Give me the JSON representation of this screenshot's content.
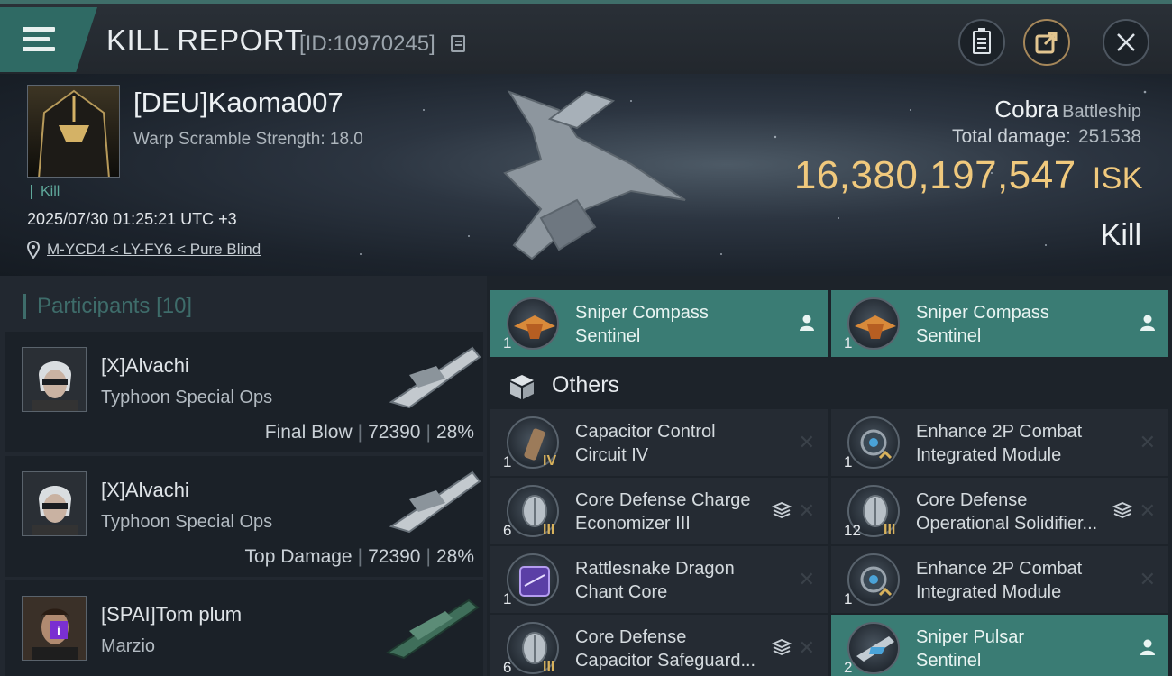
{
  "header": {
    "title": "KILL REPORT",
    "kill_id": "[ID:10970245]"
  },
  "victim": {
    "name": "[DEU]Kaoma007",
    "warp_scramble": "Warp Scramble Strength: 18.0",
    "tag": "Kill",
    "datetime": "2025/07/30 01:25:21 UTC +3",
    "location": "M-YCD4 < LY-FY6 < Pure Blind",
    "ship": "Cobra",
    "ship_class": "Battleship",
    "total_damage_label": "Total damage:",
    "total_damage": "251538",
    "isk_value": "16,380,197,547",
    "isk_unit": "ISK",
    "result": "Kill"
  },
  "participants": {
    "header": "Participants",
    "count": "[10]",
    "list": [
      {
        "name": "[X]Alvachi",
        "ship": "Typhoon Special Ops",
        "role": "Final Blow",
        "damage": "72390",
        "percent": "28%"
      },
      {
        "name": "[X]Alvachi",
        "ship": "Typhoon Special Ops",
        "role": "Top Damage",
        "damage": "72390",
        "percent": "28%"
      },
      {
        "name": "[SPAI]Tom plum",
        "ship": "Marzio"
      }
    ]
  },
  "items": {
    "top": [
      {
        "name_line1": "Sniper Compass",
        "name_line2": "Sentinel",
        "qty": "1"
      },
      {
        "name_line1": "Sniper Compass",
        "name_line2": "Sentinel",
        "qty": "1"
      }
    ],
    "section_label": "Others",
    "grid": [
      {
        "name_line1": "Capacitor Control",
        "name_line2": "Circuit IV",
        "qty": "1",
        "grade": "IV"
      },
      {
        "name_line1": "Enhance 2P Combat",
        "name_line2": "Integrated Module",
        "qty": "1"
      },
      {
        "name_line1": "Core Defense Charge",
        "name_line2": "Economizer III",
        "qty": "6",
        "grade": "III"
      },
      {
        "name_line1": "Core Defense",
        "name_line2": "Operational Solidifier...",
        "qty": "12",
        "grade": "III"
      },
      {
        "name_line1": "Rattlesnake Dragon",
        "name_line2": "Chant Core",
        "qty": "1"
      },
      {
        "name_line1": "Enhance 2P Combat",
        "name_line2": "Integrated Module",
        "qty": "1"
      },
      {
        "name_line1": "Core Defense",
        "name_line2": "Capacitor Safeguard...",
        "qty": "6",
        "grade": "III"
      },
      {
        "name_line1": "Sniper Pulsar",
        "name_line2": "Sentinel",
        "qty": "2"
      }
    ],
    "close_glyph": "✕"
  },
  "colors": {
    "accent_teal": "#3a7c74",
    "isk_gold": "#f0c97d",
    "header_teal": "#2f6a64"
  },
  "icons": [
    "menu-icon",
    "copy-icon",
    "clipboard-icon",
    "share-icon",
    "close-icon",
    "location-pin-icon",
    "person-icon",
    "stack-icon",
    "cube-icon"
  ]
}
